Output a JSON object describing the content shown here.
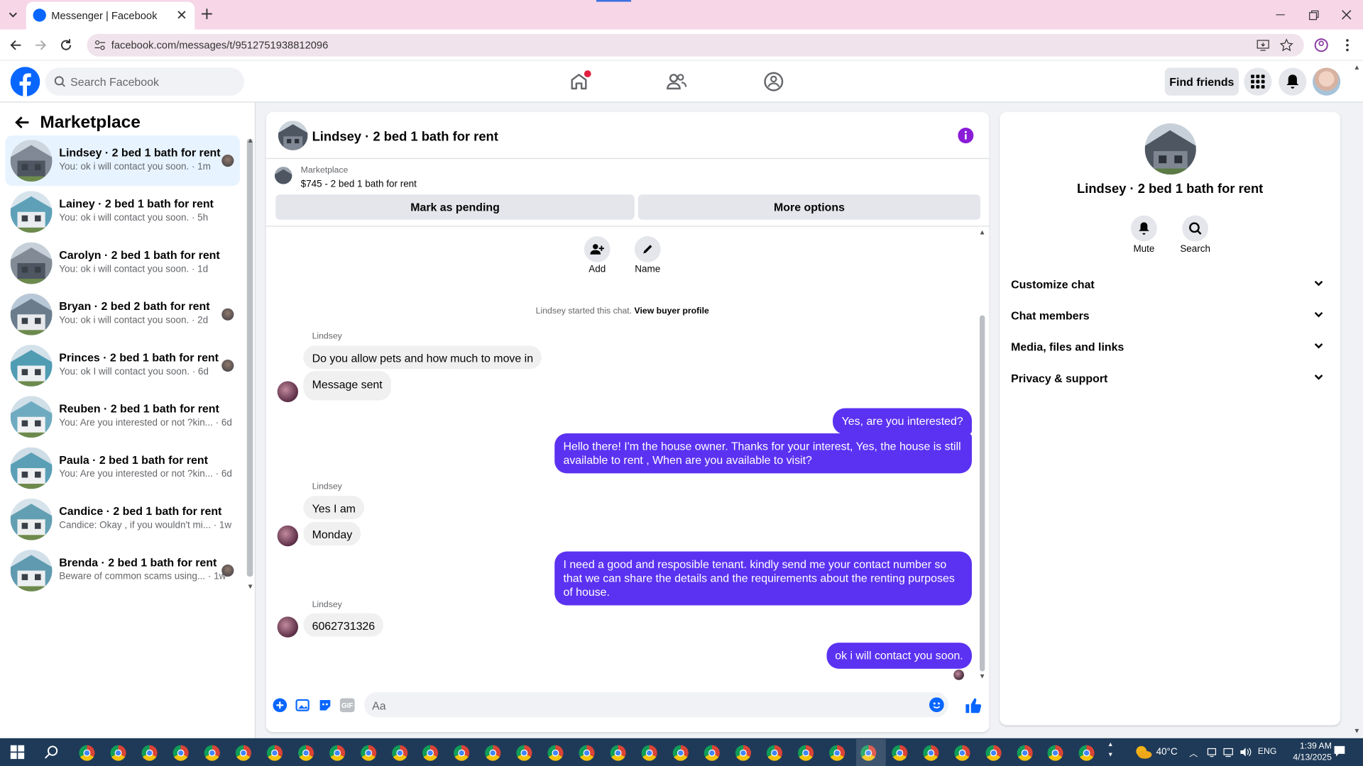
{
  "browser": {
    "tab_title": "Messenger | Facebook",
    "url": "facebook.com/messages/t/9512751938812096"
  },
  "fb": {
    "search_placeholder": "Search Facebook",
    "find_friends": "Find friends"
  },
  "sidebar": {
    "title": "Marketplace",
    "conversations": [
      {
        "name": "Lindsey · 2 bed 1 bath for rent",
        "preview": "You: ok i will contact you soon. · 1m",
        "active": true
      },
      {
        "name": "Lainey · 2 bed 1 bath for rent",
        "preview": "You: ok i will contact you soon. · 5h"
      },
      {
        "name": "Carolyn · 2 bed 1 bath for rent",
        "preview": "You: ok i will contact you soon. · 1d"
      },
      {
        "name": "Bryan · 2 bed 2 bath for rent",
        "preview": "You: ok i will contact you soon. · 2d"
      },
      {
        "name": "Princes · 2 bed 1 bath for rent",
        "preview": "You: ok I will contact you soon. · 6d"
      },
      {
        "name": "Reuben · 2 bed 1 bath for rent",
        "preview": "You: Are you interested or not ?kin... · 6d"
      },
      {
        "name": "Paula · 2 bed 1 bath for rent",
        "preview": "You: Are you interested or not ?kin... · 6d"
      },
      {
        "name": "Candice · 2 bed 1 bath for rent",
        "preview": "Candice: Okay , if you wouldn't mi... · 1w"
      },
      {
        "name": "Brenda · 2 bed 1 bath for rent",
        "preview": "Beware of common scams using... · 1w"
      }
    ]
  },
  "chat": {
    "title": "Lindsey · 2 bed 1 bath for rent",
    "listing_source": "Marketplace",
    "listing": "$745 - 2 bed 1 bath for rent",
    "mark_pending": "Mark as pending",
    "more_options": "More options",
    "add_label": "Add",
    "name_label": "Name",
    "started": "Lindsey started this chat.",
    "view_profile": "View buyer profile",
    "messages": [
      {
        "sender": "Lindsey",
        "text": "Do you allow pets and how much to move in"
      },
      {
        "text": "Message sent"
      },
      {
        "text": "Yes, are you interested?"
      },
      {
        "text": "Hello there! I'm the house owner. Thanks for your interest, Yes, the house is still available to rent , When are you available to visit?"
      },
      {
        "sender": "Lindsey",
        "text": "Yes I am"
      },
      {
        "text": "Monday"
      },
      {
        "text": "I need a good and resposible tenant.  kindly send me your contact number so that we can share the details and the requirements about the renting purposes of house."
      },
      {
        "sender": "Lindsey",
        "text": "6062731326"
      },
      {
        "text": "ok i will contact you soon."
      }
    ],
    "composer_placeholder": "Aa"
  },
  "info": {
    "name": "Lindsey · 2 bed 1 bath for rent",
    "mute": "Mute",
    "search": "Search",
    "sections": [
      "Customize chat",
      "Chat members",
      "Media, files and links",
      "Privacy & support"
    ]
  },
  "taskbar": {
    "weather": "40°C",
    "lang": "ENG",
    "time": "1:39 AM",
    "date": "4/13/2025"
  },
  "colors": {
    "accent": "#0866ff",
    "outgoing_bubble": "#5b32f1",
    "info_icon": "#8a1cd8"
  }
}
